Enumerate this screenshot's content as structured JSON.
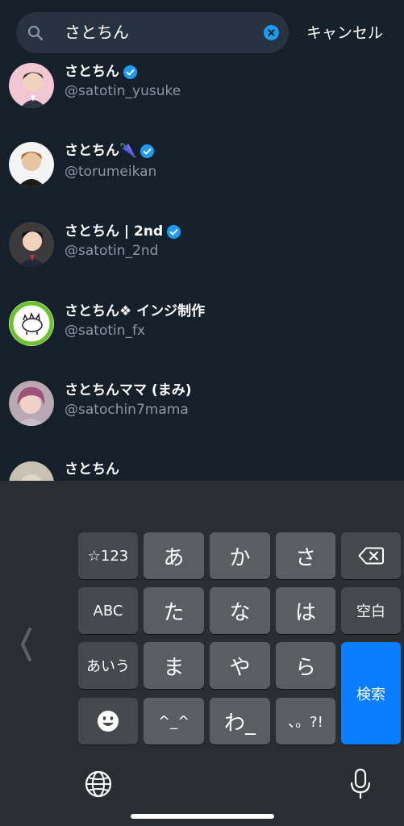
{
  "search": {
    "query": "さとちん",
    "cancel_label": "キャンセル"
  },
  "results": [
    {
      "name": "さとちん",
      "handle": "@satotin_yusuke",
      "verified": true
    },
    {
      "name": "さとちん🌂",
      "handle": "@torumeikan",
      "verified": true
    },
    {
      "name": "さとちん | 2nd",
      "handle": "@satotin_2nd",
      "verified": true
    },
    {
      "name": "さとちん❖ インジ制作",
      "handle": "@satotin_fx",
      "verified": false
    },
    {
      "name": "さとちんママ (まみ)",
      "handle": "@satochin7mama",
      "verified": false
    },
    {
      "name": "さとちん",
      "handle": "",
      "verified": false
    }
  ],
  "keyboard": {
    "row1": [
      "☆123",
      "あ",
      "か",
      "さ"
    ],
    "row2": [
      "ABC",
      "た",
      "な",
      "は",
      "空白"
    ],
    "row3": [
      "あいう",
      "ま",
      "や",
      "ら"
    ],
    "row4": [
      "^_^",
      "わ_",
      "、。?!"
    ],
    "search_key": "検索",
    "icons": [
      "backspace-icon",
      "emoji-icon",
      "globe-icon",
      "microphone-icon",
      "chevron-left-icon"
    ]
  },
  "colors": {
    "background": "#15202b",
    "verified": "#1d9bf0",
    "search_key": "#0a7cff"
  }
}
